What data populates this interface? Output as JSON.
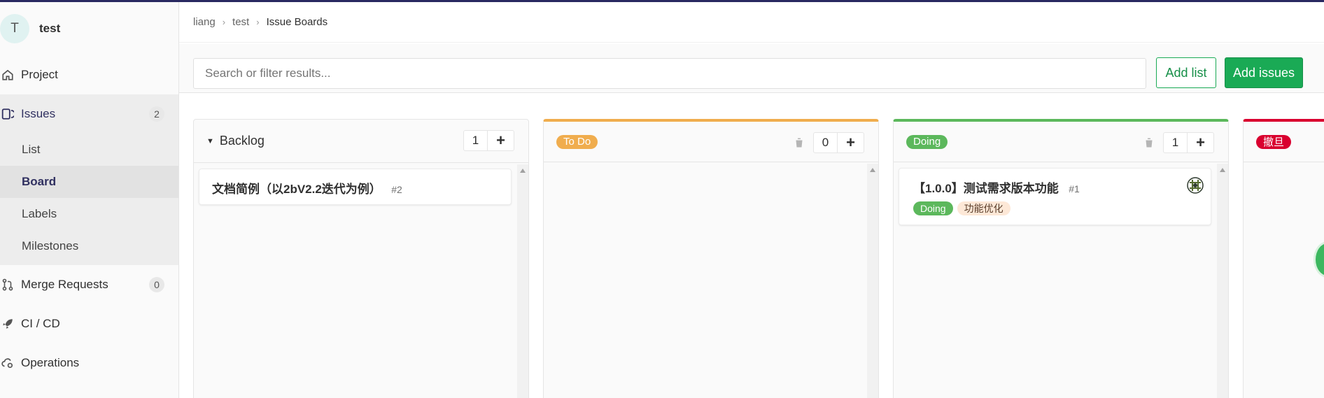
{
  "project": {
    "avatar_letter": "T",
    "name": "test"
  },
  "sidebar": {
    "items": [
      {
        "label": "Project",
        "icon": "home-icon"
      },
      {
        "label": "Issues",
        "icon": "issues-icon",
        "badge": "2"
      },
      {
        "label": "Merge Requests",
        "icon": "merge-request-icon",
        "badge": "0"
      },
      {
        "label": "CI / CD",
        "icon": "rocket-icon"
      },
      {
        "label": "Operations",
        "icon": "cloud-gear-icon"
      }
    ],
    "issues_sub": [
      {
        "label": "List"
      },
      {
        "label": "Board"
      },
      {
        "label": "Labels"
      },
      {
        "label": "Milestones"
      }
    ]
  },
  "breadcrumb": {
    "items": [
      "liang",
      "test",
      "Issue Boards"
    ]
  },
  "filter": {
    "placeholder": "Search or filter results..."
  },
  "buttons": {
    "add_list": "Add list",
    "add_issues": "Add issues"
  },
  "colors": {
    "todo": "#f0ad4e",
    "doing": "#5cb85c",
    "cancel": "#d9002f",
    "accent_green": "#1aaa55"
  },
  "lists": [
    {
      "title": "Backlog",
      "count": "1",
      "cards": [
        {
          "title": "文档简例（以2bV2.2迭代为例）",
          "number": "#2",
          "labels": []
        }
      ]
    },
    {
      "title": "To Do",
      "count": "0",
      "cards": []
    },
    {
      "title": "Doing",
      "count": "1",
      "cards": [
        {
          "title": "【1.0.0】测试需求版本功能",
          "number": "#1",
          "labels": [
            "Doing",
            "功能优化"
          ]
        }
      ]
    },
    {
      "title": "撤旦",
      "count": "",
      "cards": []
    }
  ]
}
